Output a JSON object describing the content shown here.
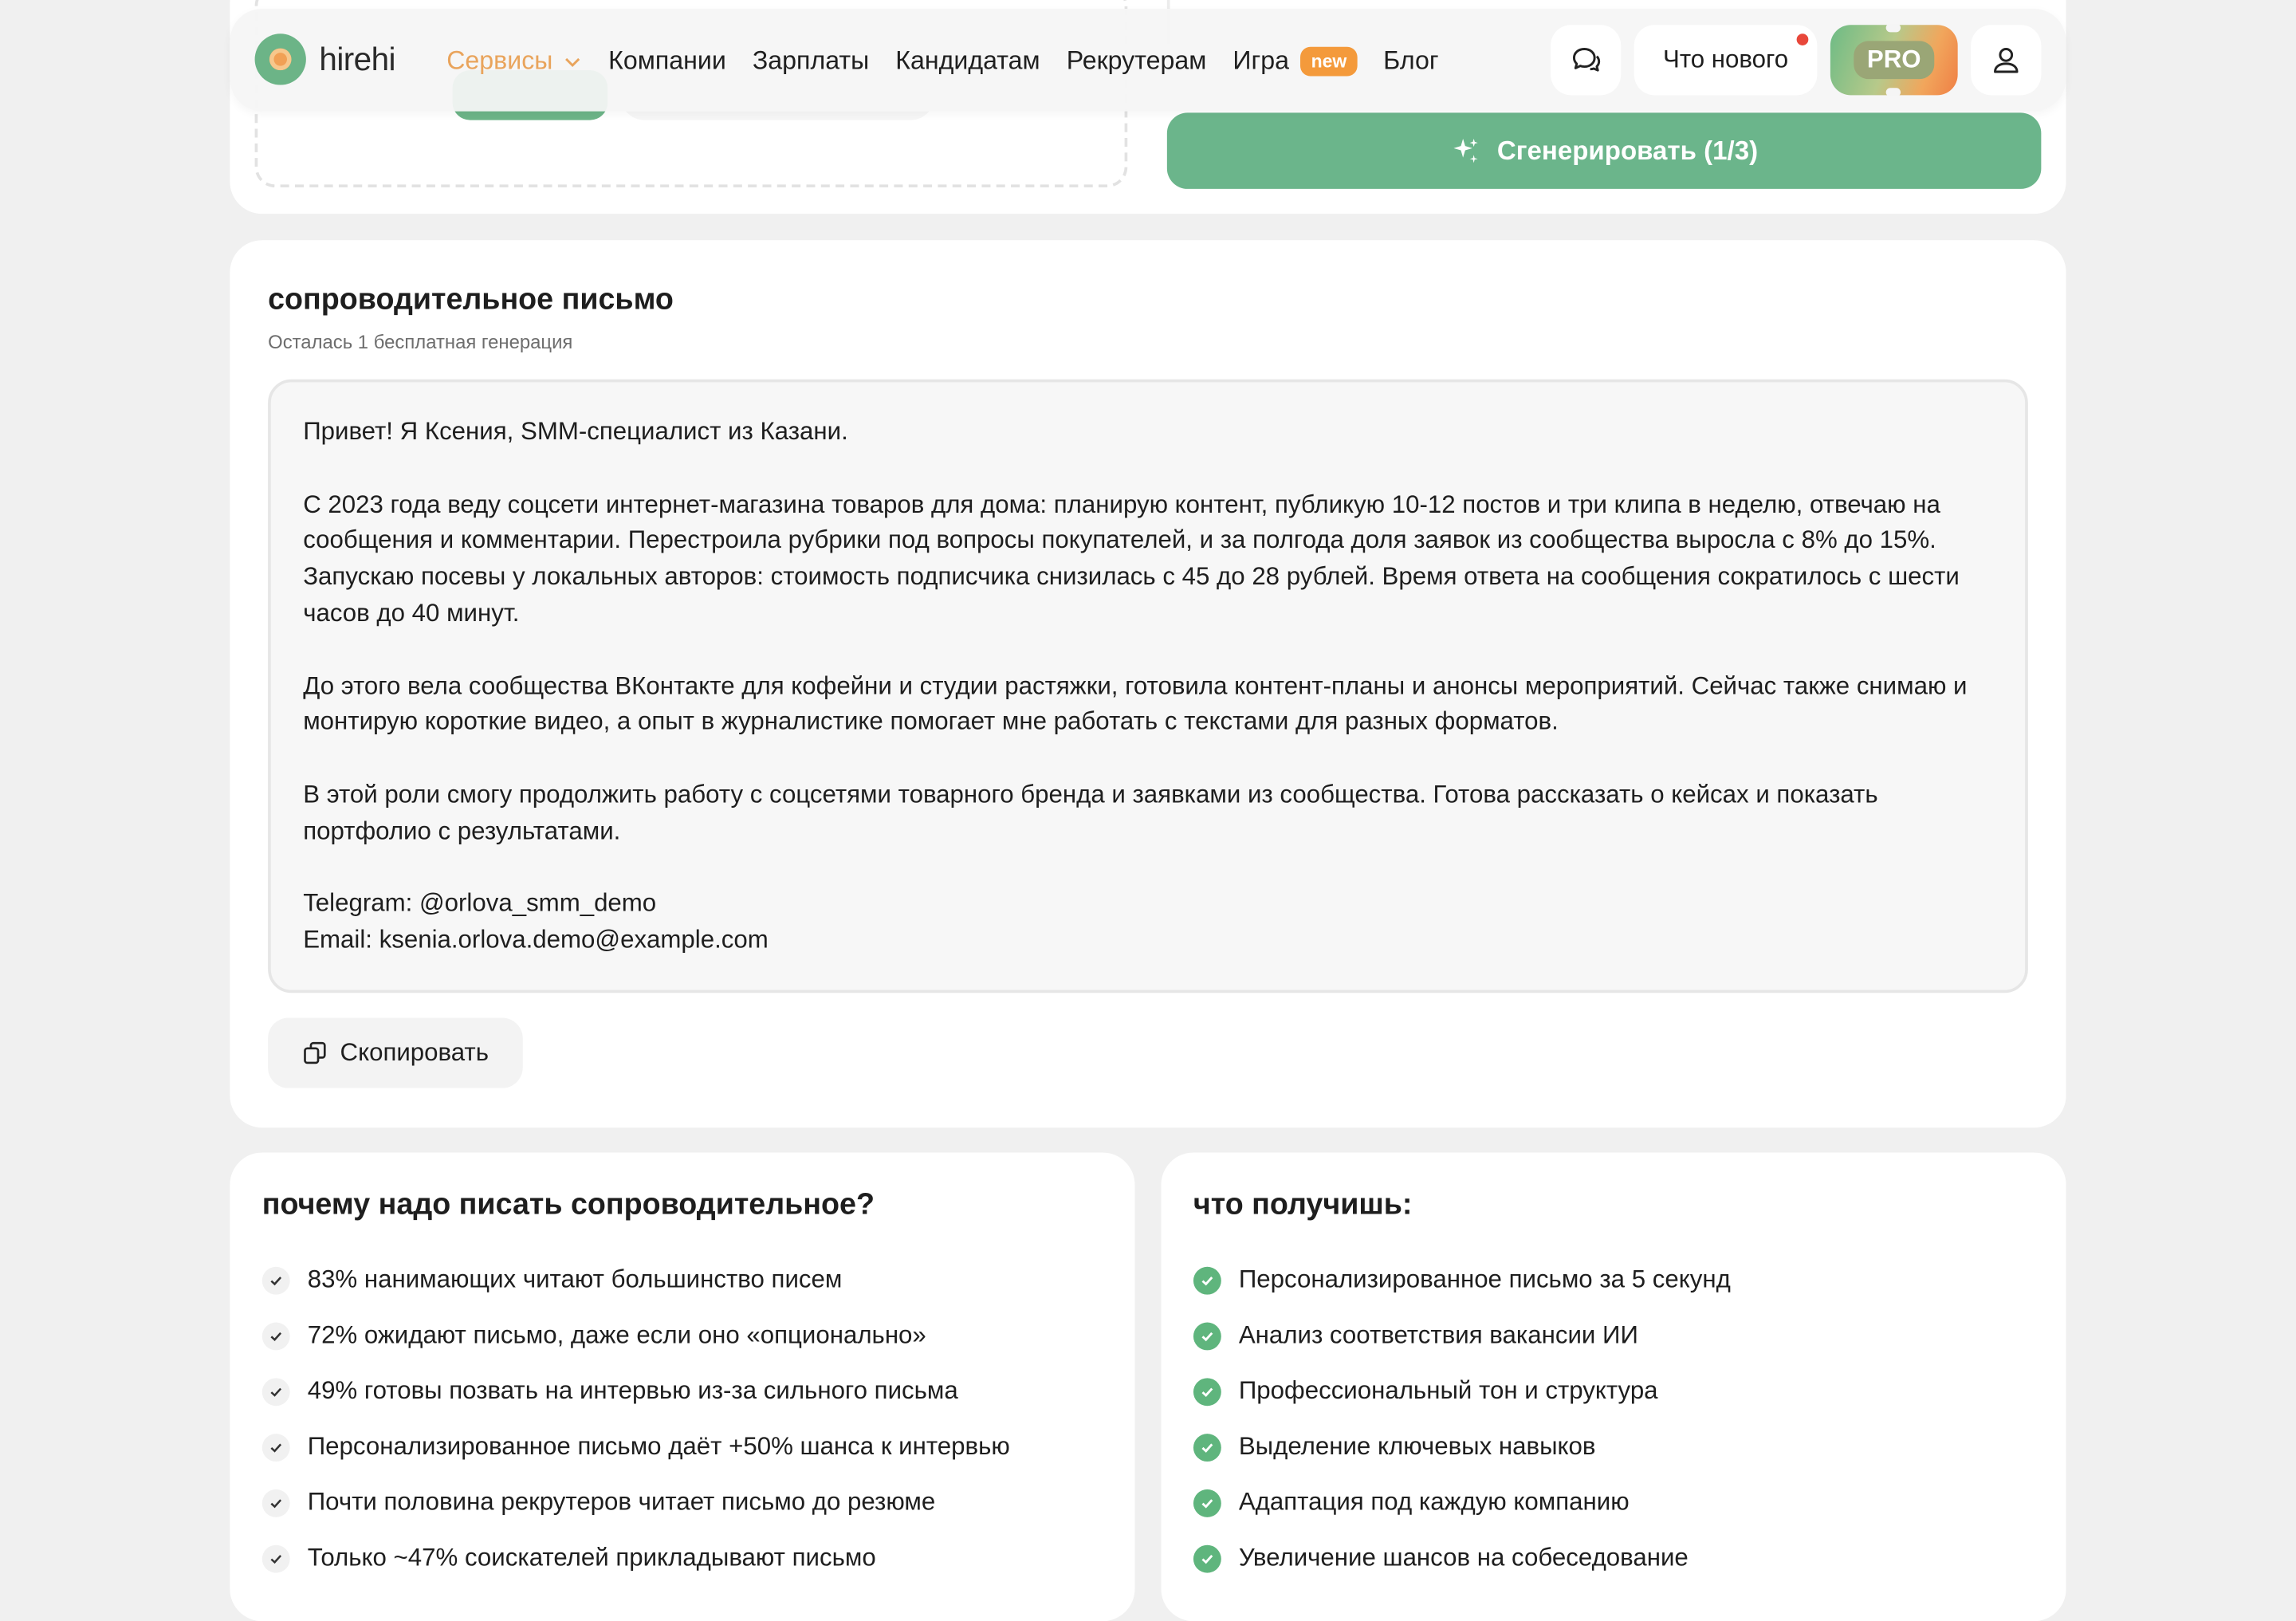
{
  "brand": {
    "name": "hirehi"
  },
  "nav": {
    "links": [
      "Сервисы",
      "Компании",
      "Зарплаты",
      "Кандидатам",
      "Рекрутерам",
      "Игра",
      "Блог"
    ],
    "new_badge": "new",
    "whats_new": "Что нового",
    "pro": "PRO"
  },
  "generator": {
    "button_label": "Сгенерировать (1/3)"
  },
  "letter": {
    "title": "сопроводительное письмо",
    "subtitle": "Осталась 1 бесплатная генерация",
    "paragraphs": [
      "Привет! Я Ксения, SMM-специалист из Казани.",
      "С 2023 года веду соцсети интернет-магазина товаров для дома: планирую контент, публикую 10-12 постов и три клипа в неделю, отвечаю на сообщения и комментарии. Перестроила рубрики под вопросы покупателей, и за полгода доля заявок из сообщества выросла с 8% до 15%. Запускаю посевы у локальных авторов: стоимость подписчика снизилась с 45 до 28 рублей. Время ответа на сообщения сократилось с шести часов до 40 минут.",
      "До этого вела сообщества ВКонтакте для кофейни и студии растяжки, готовила контент-планы и анонсы мероприятий. Сейчас также снимаю и монтирую короткие видео, а опыт в журналистике помогает мне работать с текстами для разных форматов.",
      "В этой роли смогу продолжить работу с соцсетями товарного бренда и заявками из сообщества. Готова рассказать о кейсах и показать портфолио с результатами.",
      "Telegram: @orlova_smm_demo",
      "Email: ksenia.orlova.demo@example.com"
    ],
    "copy_label": "Скопировать"
  },
  "why": {
    "title": "почему надо писать сопроводительное?",
    "items": [
      "83% нанимающих читают большинство писем",
      "72% ожидают письмо, даже если оно «опционально»",
      "49% готовы позвать на интервью из-за сильного письма",
      "Персонализированное письмо даёт +50% шанса к интервью",
      "Почти половина рекрутеров читает письмо до резюме",
      "Только ~47% соискателей прикладывают письмо"
    ]
  },
  "get": {
    "title": "что получишь:",
    "items": [
      "Персонализированное письмо за 5 секунд",
      "Анализ соответствия вакансии ИИ",
      "Профессиональный тон и структура",
      "Выделение ключевых навыков",
      "Адаптация под каждую компанию",
      "Увеличение шансов на собеседование"
    ]
  },
  "colors": {
    "accent_green": "#6bb58b",
    "accent_orange": "#f49a3b",
    "notification_red": "#e8473a"
  },
  "icons": [
    "sparkle-icon",
    "chevron-down-icon",
    "chat-icon",
    "user-icon",
    "copy-icon",
    "check-icon"
  ]
}
